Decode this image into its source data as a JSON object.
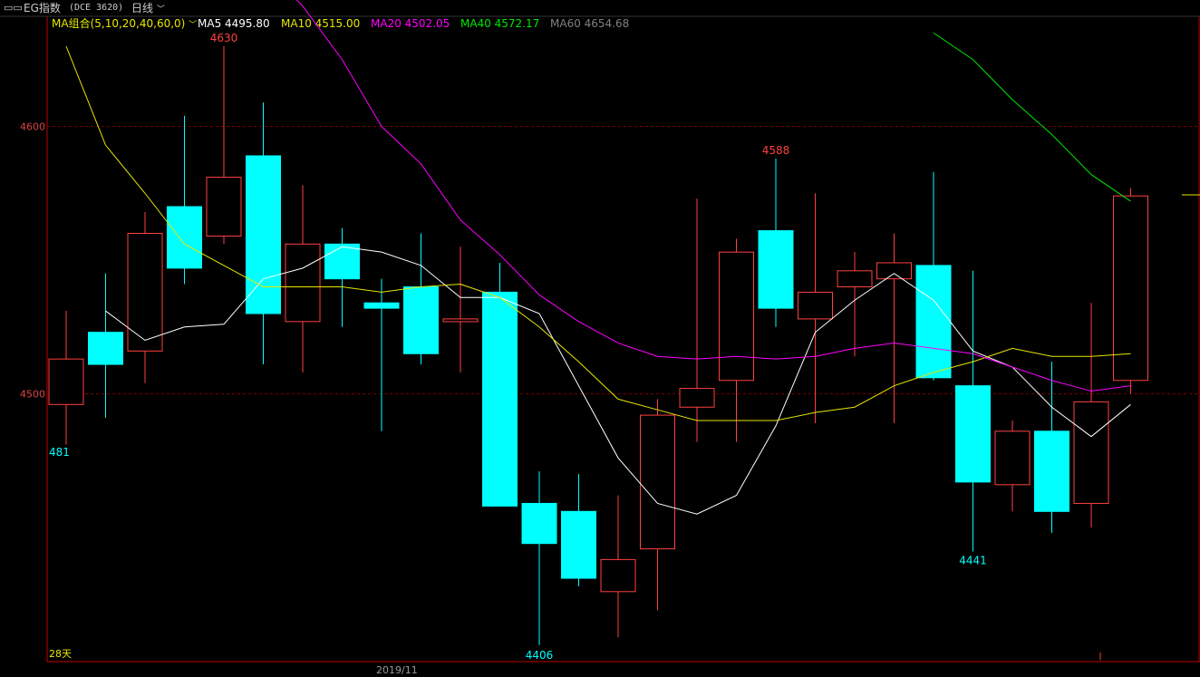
{
  "topbar": {
    "menu_icon": "window-menu-icon",
    "symbol_label": "EG指数",
    "exchange_code": "(DCE 3620)",
    "period_label": "日线",
    "period_icon": "chevron-down-icon"
  },
  "legend": {
    "ma_group_label": "MA组合(5,10,20,40,60,0)",
    "ma_group_icon": "chevron-down-icon",
    "items": [
      {
        "label": "MA5 4495.80",
        "color": "#ffffff"
      },
      {
        "label": "MA10 4515.00",
        "color": "#e6e600"
      },
      {
        "label": "MA20 4502.05",
        "color": "#ff00ff"
      },
      {
        "label": "MA40 4572.17",
        "color": "#00e600"
      },
      {
        "label": "MA60 4654.68",
        "color": "#808080"
      }
    ]
  },
  "colors": {
    "up": "#ff4040",
    "down": "#00ffff",
    "grid": "#7a0000",
    "frame": "#c00000"
  },
  "footer": {
    "days_label": "28天",
    "date_label": "2019/11"
  },
  "chart_data": {
    "type": "candlestick",
    "y_ticks": [
      4600,
      4500
    ],
    "ylim": [
      4400,
      4635
    ],
    "max_annotation": {
      "value": "4630",
      "index": 4
    },
    "min_annotation": {
      "value": "4406",
      "index": 12
    },
    "local_high_annotation": {
      "value": "4588",
      "index": 18
    },
    "local_low_annotation": {
      "value": "4441",
      "index": 23
    },
    "left_edge_label": "481",
    "candles": [
      {
        "o": 4496,
        "h": 4531,
        "l": 4481,
        "c": 4513
      },
      {
        "o": 4523,
        "h": 4545,
        "l": 4491,
        "c": 4511
      },
      {
        "o": 4516,
        "h": 4568,
        "l": 4504,
        "c": 4560
      },
      {
        "o": 4570,
        "h": 4604,
        "l": 4541,
        "c": 4547
      },
      {
        "o": 4559,
        "h": 4630,
        "l": 4556,
        "c": 4581
      },
      {
        "o": 4589,
        "h": 4609,
        "l": 4511,
        "c": 4530
      },
      {
        "o": 4527,
        "h": 4578,
        "l": 4508,
        "c": 4556
      },
      {
        "o": 4556,
        "h": 4562,
        "l": 4525,
        "c": 4543
      },
      {
        "o": 4534,
        "h": 4543,
        "l": 4486,
        "c": 4532
      },
      {
        "o": 4540,
        "h": 4560,
        "l": 4511,
        "c": 4515
      },
      {
        "o": 4528,
        "h": 4555,
        "l": 4508,
        "c": 4528
      },
      {
        "o": 4538,
        "h": 4549,
        "l": 4458,
        "c": 4458
      },
      {
        "o": 4459,
        "h": 4471,
        "l": 4406,
        "c": 4444
      },
      {
        "o": 4456,
        "h": 4470,
        "l": 4428,
        "c": 4431
      },
      {
        "o": 4426,
        "h": 4462,
        "l": 4409,
        "c": 4438
      },
      {
        "o": 4442,
        "h": 4498,
        "l": 4419,
        "c": 4492
      },
      {
        "o": 4495,
        "h": 4573,
        "l": 4482,
        "c": 4502
      },
      {
        "o": 4505,
        "h": 4558,
        "l": 4482,
        "c": 4553
      },
      {
        "o": 4561,
        "h": 4588,
        "l": 4525,
        "c": 4532
      },
      {
        "o": 4528,
        "h": 4575,
        "l": 4489,
        "c": 4538
      },
      {
        "o": 4540,
        "h": 4553,
        "l": 4514,
        "c": 4546
      },
      {
        "o": 4543,
        "h": 4560,
        "l": 4489,
        "c": 4549
      },
      {
        "o": 4548,
        "h": 4583,
        "l": 4505,
        "c": 4506
      },
      {
        "o": 4503,
        "h": 4546,
        "l": 4441,
        "c": 4467
      },
      {
        "o": 4466,
        "h": 4490,
        "l": 4456,
        "c": 4486
      },
      {
        "o": 4486,
        "h": 4512,
        "l": 4448,
        "c": 4456
      },
      {
        "o": 4459,
        "h": 4534,
        "l": 4450,
        "c": 4497
      },
      {
        "o": 4505,
        "h": 4577,
        "l": 4500,
        "c": 4574
      }
    ],
    "ma_series": [
      {
        "name": "MA5",
        "color": "#ffffff",
        "values": [
          4531,
          4520,
          4525,
          4526,
          4543,
          4547,
          4555,
          4553,
          4548,
          4536,
          4536,
          4530,
          4503,
          4476,
          4459,
          4455,
          4462,
          4488,
          4523,
          4535,
          4545,
          4535,
          4516,
          4510,
          4495,
          4484,
          4496
        ]
      },
      {
        "name": "MA10",
        "color": "#e6e600",
        "values": [
          4630,
          4593,
          4575,
          4556,
          4548,
          4540,
          4540,
          4540,
          4538,
          4540,
          4541,
          4536,
          4525,
          4512,
          4498,
          4494,
          4490,
          4490,
          4490,
          4493,
          4495,
          4503,
          4508,
          4512,
          4517,
          4514,
          4514,
          4515
        ]
      },
      {
        "name": "MA20",
        "color": "#ff00ff",
        "values": [
          4675,
          4670,
          4660,
          4645,
          4625,
          4600,
          4586,
          4565,
          4552,
          4537,
          4527,
          4519,
          4514,
          4513,
          4514,
          4513,
          4514,
          4517,
          4519,
          4517,
          4515,
          4510,
          4505,
          4501,
          4503
        ]
      },
      {
        "name": "MA40",
        "color": "#00e600",
        "values": [
          4635,
          4625,
          4610,
          4597,
          4582,
          4572
        ]
      }
    ]
  }
}
